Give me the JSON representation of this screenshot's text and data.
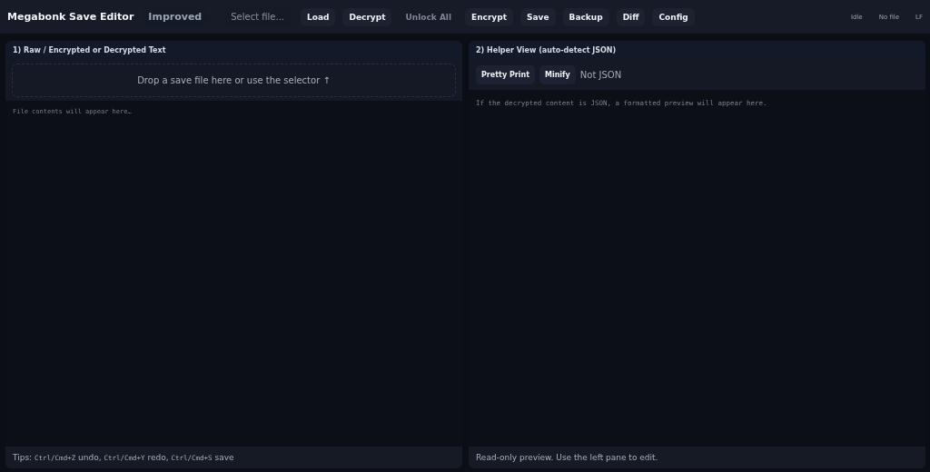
{
  "header": {
    "title": "Megabonk Save Editor",
    "badge": "Improved",
    "file_select": {
      "placeholder": "Select file..."
    },
    "buttons": [
      {
        "label": "Load",
        "disabled": false
      },
      {
        "label": "Decrypt",
        "disabled": false
      },
      {
        "label": "Unlock All",
        "disabled": true
      },
      {
        "label": "Encrypt",
        "disabled": false
      },
      {
        "label": "Save",
        "disabled": false
      },
      {
        "label": "Backup",
        "disabled": false
      },
      {
        "label": "Diff",
        "disabled": false
      },
      {
        "label": "Config",
        "disabled": false
      }
    ],
    "status": [
      "Idle",
      "No file",
      "LF"
    ]
  },
  "left_pane": {
    "title": "1) Raw / Encrypted or Decrypted Text",
    "drop_zone": "Drop a save file here or use the selector ↑",
    "editor": {
      "placeholder": "File contents will appear here…"
    },
    "tips": [
      {
        "kind": "text",
        "text": "Tips:"
      },
      {
        "kind": "key",
        "text": "Ctrl/Cmd+Z"
      },
      {
        "kind": "text",
        "text": "undo,"
      },
      {
        "kind": "key",
        "text": "Ctrl/Cmd+Y"
      },
      {
        "kind": "text",
        "text": "redo,"
      },
      {
        "kind": "key",
        "text": "Ctrl/Cmd+S"
      },
      {
        "kind": "text",
        "text": "save"
      }
    ]
  },
  "right_pane": {
    "title": "2) Helper View (auto-detect JSON)",
    "buttons": [
      "Pretty Print",
      "Minify"
    ],
    "json_status": "Not JSON",
    "preview": {
      "placeholder": "If the decrypted content is JSON, a formatted preview will appear here."
    },
    "footer": "Read-only preview. Use the left pane to edit."
  }
}
